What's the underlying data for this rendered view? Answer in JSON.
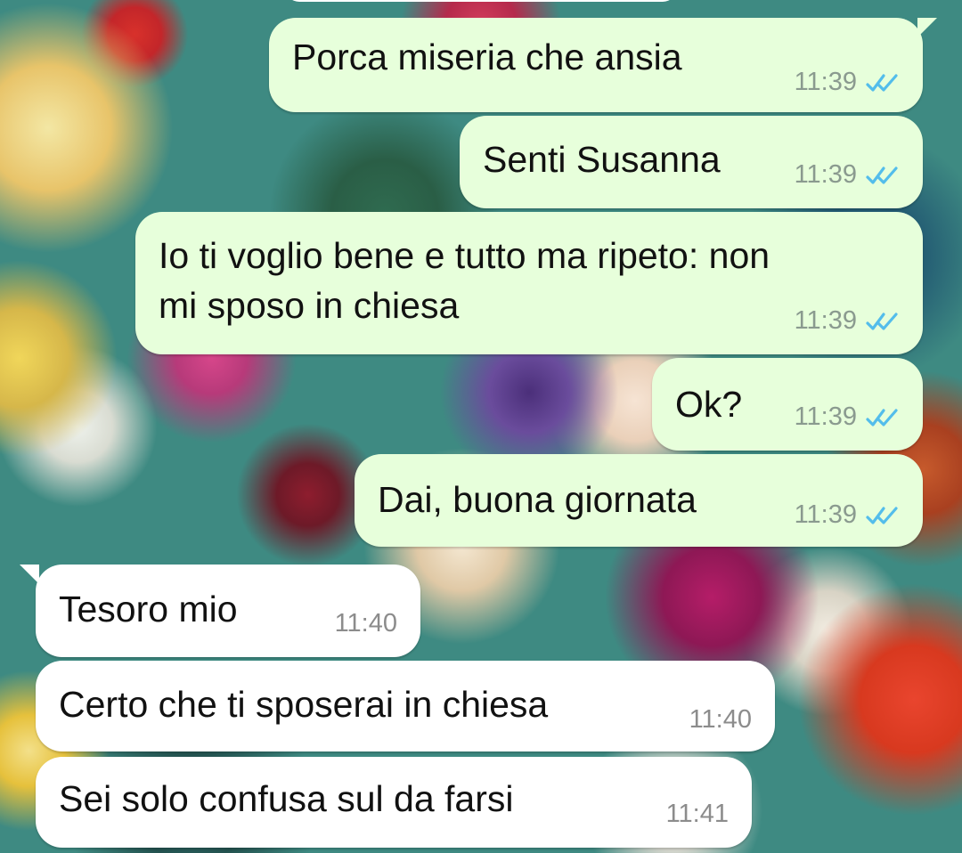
{
  "chat": {
    "messages": [
      {
        "direction": "out",
        "text": "Porca miseria che ansia",
        "time": "11:39",
        "status": "read"
      },
      {
        "direction": "out",
        "text": "Senti Susanna",
        "time": "11:39",
        "status": "read"
      },
      {
        "direction": "out",
        "text": "Io ti voglio bene e tutto ma ripeto: non\nmi sposo in chiesa",
        "time": "11:39",
        "status": "read"
      },
      {
        "direction": "out",
        "text": "Ok?",
        "time": "11:39",
        "status": "read"
      },
      {
        "direction": "out",
        "text": "Dai, buona giornata",
        "time": "11:39",
        "status": "read"
      },
      {
        "direction": "in",
        "text": "Tesoro mio",
        "time": "11:40"
      },
      {
        "direction": "in",
        "text": "Certo che ti sposerai in chiesa",
        "time": "11:40"
      },
      {
        "direction": "in",
        "text": "Sei solo confusa sul da farsi",
        "time": "11:41"
      }
    ]
  },
  "colors": {
    "outgoing_bubble": "#e7ffdb",
    "incoming_bubble": "#ffffff",
    "read_tick": "#53bdeb",
    "time_text": "#8a9a8f"
  },
  "icons": {
    "read_status": "double-check-icon"
  }
}
